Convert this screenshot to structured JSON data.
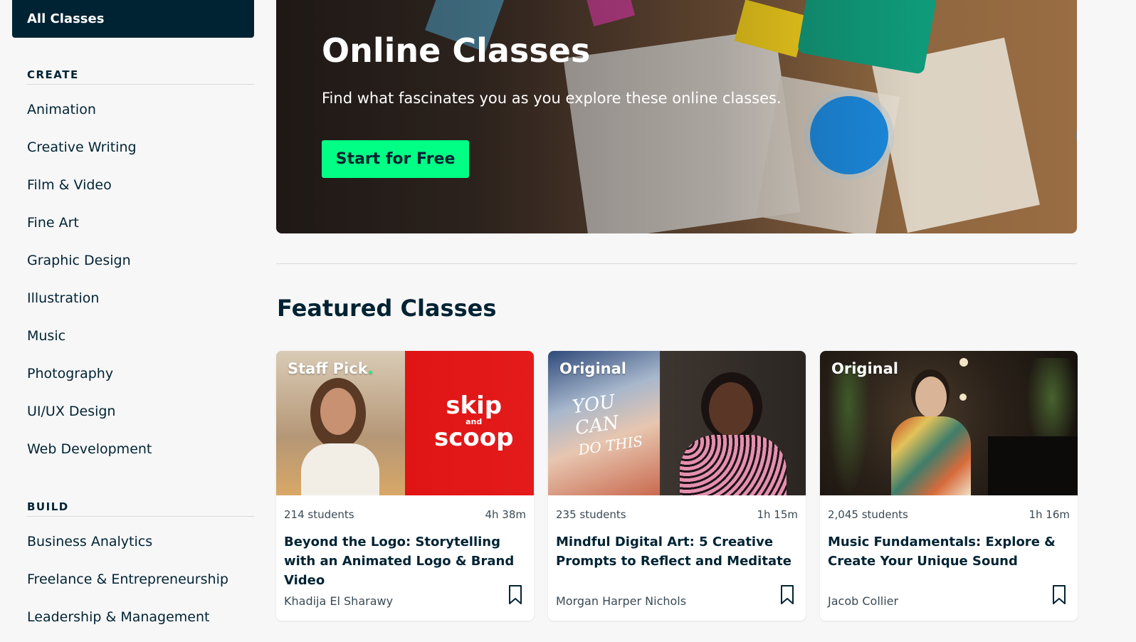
{
  "sidebar": {
    "all_classes_label": "All Classes",
    "sections": [
      {
        "title": "CREATE",
        "items": [
          "Animation",
          "Creative Writing",
          "Film & Video",
          "Fine Art",
          "Graphic Design",
          "Illustration",
          "Music",
          "Photography",
          "UI/UX Design",
          "Web Development"
        ]
      },
      {
        "title": "BUILD",
        "items": [
          "Business Analytics",
          "Freelance & Entrepreneurship",
          "Leadership & Management"
        ]
      }
    ]
  },
  "hero": {
    "title": "Online Classes",
    "subtitle": "Find what fascinates you as you explore these online classes.",
    "cta_label": "Start for Free"
  },
  "featured": {
    "title": "Featured Classes",
    "cards": [
      {
        "badge": "Staff Pick",
        "badge_dot": ".",
        "thumb_text_1": "skip",
        "thumb_text_2": "and",
        "thumb_text_3": "scoop",
        "students": "214 students",
        "duration": "4h 38m",
        "title": "Beyond the Logo: Storytelling with an Animated Logo & Brand Video",
        "teacher": "Khadija El Sharawy"
      },
      {
        "badge": "Original",
        "thumb_text_1": "YOU",
        "thumb_text_2": "CAN",
        "thumb_text_3": "DO THIS",
        "students": "235 students",
        "duration": "1h 15m",
        "title": "Mindful Digital Art: 5 Creative Prompts to Reflect and Meditate",
        "teacher": "Morgan Harper Nichols"
      },
      {
        "badge": "Original",
        "students": "2,045 students",
        "duration": "1h 16m",
        "title": "Music Fundamentals: Explore & Create Your Unique Sound",
        "teacher": "Jacob Collier"
      }
    ]
  },
  "colors": {
    "brand_dark": "#002333",
    "brand_green": "#00ff84",
    "page_bg": "#f7f7f8"
  }
}
